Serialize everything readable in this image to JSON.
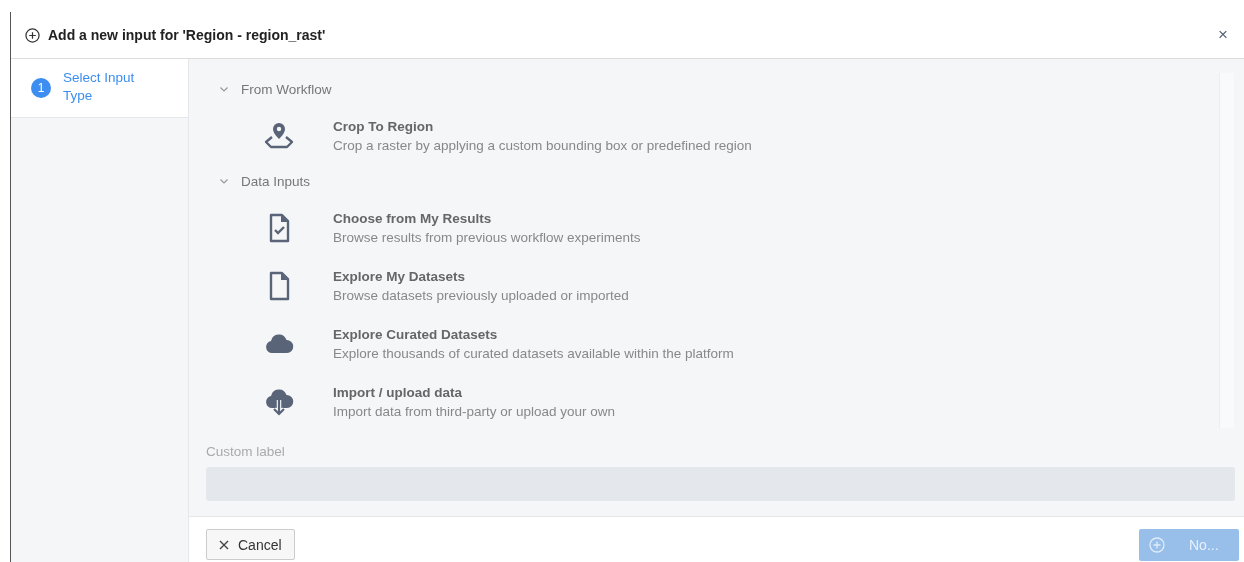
{
  "dialog": {
    "title": "Add a new input for 'Region - region_rast'",
    "close": "×"
  },
  "steps": [
    {
      "number": "1",
      "label": "Select Input Type",
      "selected": true
    }
  ],
  "sections": [
    {
      "title": "From Workflow",
      "expanded": true,
      "items": [
        {
          "kind": "pin",
          "title": "Crop To Region",
          "description": "Crop a raster by applying a custom bounding box or predefined region"
        }
      ]
    },
    {
      "title": "Data Inputs",
      "expanded": true,
      "items": [
        {
          "kind": "checkfile",
          "title": "Choose from My Results",
          "description": "Browse results from previous workflow experiments"
        },
        {
          "kind": "file",
          "title": "Explore My Datasets",
          "description": "Browse datasets previously uploaded or imported"
        },
        {
          "kind": "cloud",
          "title": "Explore Curated Datasets",
          "description": "Explore thousands of curated datasets available within the platform"
        },
        {
          "kind": "cloud-download",
          "title": "Import / upload data",
          "description": "Import data from third-party or upload your own"
        }
      ]
    }
  ],
  "custom_label": {
    "label": "Custom label"
  },
  "footer": {
    "cancel": "Cancel",
    "next": {
      "label": "No...",
      "disabled": true
    }
  }
}
